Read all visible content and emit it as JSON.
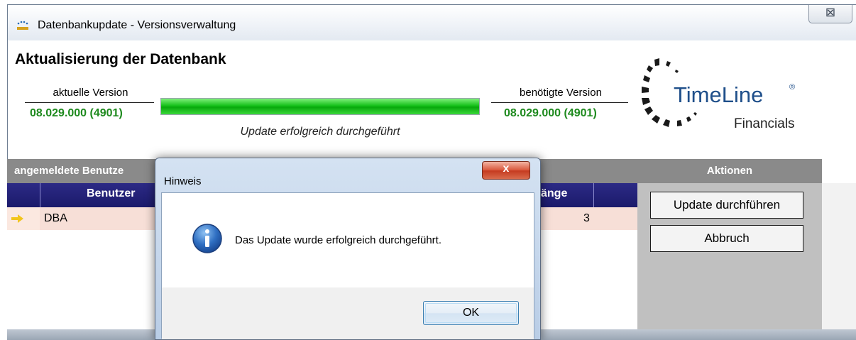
{
  "window": {
    "title": "Datenbankupdate - Versionsverwaltung",
    "close_glyph": "☒"
  },
  "main": {
    "heading": "Aktualisierung der Datenbank",
    "current_version_label": "aktuelle Version",
    "current_version_value": "08.029.000 (4901)",
    "required_version_label": "benötigte Version",
    "required_version_value": "08.029.000 (4901)",
    "progress_percent": 100,
    "status_text": "Update erfolgreich durchgeführt"
  },
  "logo": {
    "name": "TimeLine",
    "reg_mark": "®",
    "subtitle": "Financials"
  },
  "users_panel": {
    "header": "angemeldete Benutze",
    "columns": [
      "Benutzer",
      "änge"
    ],
    "rows": [
      {
        "user": "DBA",
        "count": "3"
      }
    ]
  },
  "actions_panel": {
    "header": "Aktionen",
    "update_button": "Update durchführen",
    "cancel_button": "Abbruch"
  },
  "dialog": {
    "title": "Hinweis",
    "close_glyph": "x",
    "message": "Das Update wurde erfolgreich durchgeführt.",
    "ok_button": "OK"
  },
  "colors": {
    "version_green": "#1e8a1e",
    "grid_header": "#1b1a6b",
    "row_highlight": "#f7dfd7",
    "panel_gray": "#8a8a8a",
    "logo_blue": "#1f4f8a"
  }
}
